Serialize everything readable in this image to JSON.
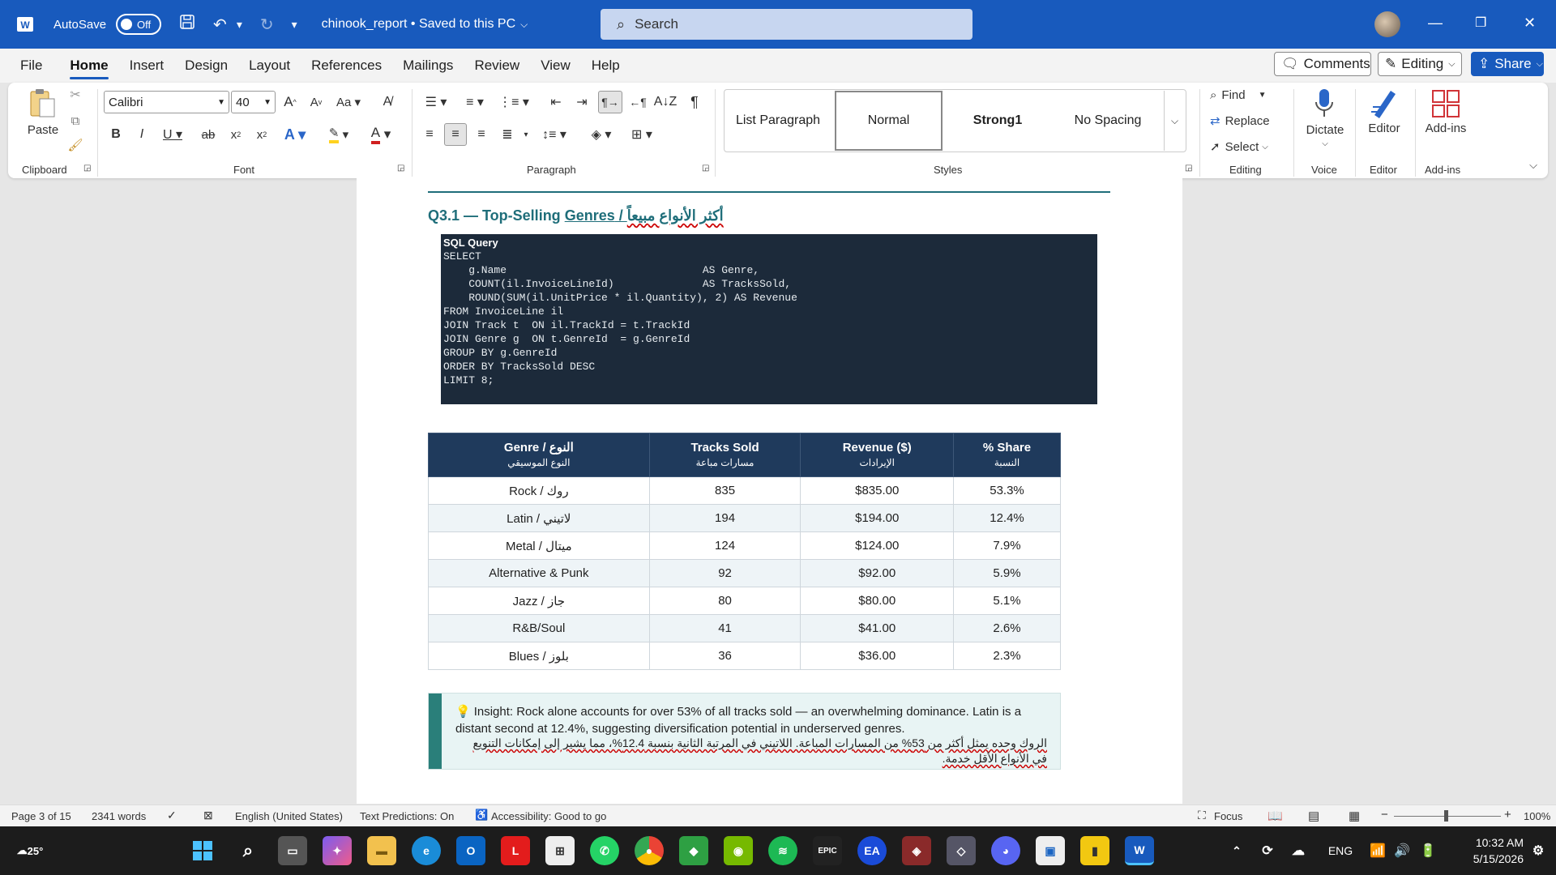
{
  "titlebar": {
    "autosave_label": "AutoSave",
    "autosave_state": "Off",
    "doc_title": "chinook_report • Saved to this PC",
    "search_placeholder": "Search"
  },
  "menu": {
    "items": [
      "File",
      "Home",
      "Insert",
      "Design",
      "Layout",
      "References",
      "Mailings",
      "Review",
      "View",
      "Help"
    ],
    "active": "Home",
    "comments_label": "Comments",
    "editing_label": "Editing",
    "share_label": "Share"
  },
  "ribbon": {
    "paste_label": "Paste",
    "clipboard_label": "Clipboard",
    "font_name": "Calibri",
    "font_size": "40",
    "font_group": "Font",
    "paragraph_group": "Paragraph",
    "styles": [
      "List Paragraph",
      "Normal",
      "Strong1",
      "No Spacing"
    ],
    "styles_group": "Styles",
    "find_label": "Find",
    "replace_label": "Replace",
    "select_label": "Select",
    "editing_group": "Editing",
    "dictate_label": "Dictate",
    "voice_group": "Voice",
    "editor_label": "Editor",
    "editor_group": "Editor",
    "addins_label": "Add-ins",
    "addins_group": "Add-ins"
  },
  "document": {
    "heading_prefix": "Q3.1 — Top-Selling ",
    "heading_genres": "Genres",
    "heading_sep": " / ",
    "heading_ar": "أكثر الأنواع مبيعاً",
    "code_header": "SQL Query",
    "code_body": "SELECT\n    g.Name                               AS Genre,\n    COUNT(il.InvoiceLineId)              AS TracksSold,\n    ROUND(SUM(il.UnitPrice * il.Quantity), 2) AS Revenue\nFROM InvoiceLine il\nJOIN Track t  ON il.TrackId = t.TrackId\nJOIN Genre g  ON t.GenreId  = g.GenreId\nGROUP BY g.GenreId\nORDER BY TracksSold DESC\nLIMIT 8;",
    "table": {
      "headers": [
        {
          "en": "Genre / النوع",
          "ar": "النوع الموسيقي"
        },
        {
          "en": "Tracks Sold",
          "ar": "مسارات مباعة"
        },
        {
          "en": "Revenue ($)",
          "ar": "الإيرادات"
        },
        {
          "en": "% Share",
          "ar": "النسبة"
        }
      ],
      "rows": [
        [
          "Rock / روك",
          "835",
          "$835.00",
          "53.3%"
        ],
        [
          "Latin / لاتيني",
          "194",
          "$194.00",
          "12.4%"
        ],
        [
          "Metal / ميتال",
          "124",
          "$124.00",
          "7.9%"
        ],
        [
          "Alternative & Punk",
          "92",
          "$92.00",
          "5.9%"
        ],
        [
          "Jazz / جاز",
          "80",
          "$80.00",
          "5.1%"
        ],
        [
          "R&B/Soul",
          "41",
          "$41.00",
          "2.6%"
        ],
        [
          "Blues / بلوز",
          "36",
          "$36.00",
          "2.3%"
        ]
      ]
    },
    "insight_en": "Insight: Rock alone accounts for over 53% of all tracks sold — an overwhelming dominance. Latin is a distant second at 12.4%, suggesting diversification potential in underserved genres.",
    "insight_ar": "الروك وحده يمثل أكثر من 53% من المسارات المباعة. اللاتيني في المرتبة الثانية بنسبة 12.4%، مما يشير إلى إمكانات التنويع في الأنواع الأقل خدمة."
  },
  "statusbar": {
    "page": "Page 3 of 15",
    "words": "2341 words",
    "language": "English (United States)",
    "predictions": "Text Predictions: On",
    "accessibility": "Accessibility: Good to go",
    "focus": "Focus",
    "zoom": "100%"
  },
  "taskbar": {
    "weather": "25°",
    "lang": "ENG",
    "time": "10:32 AM",
    "date": "5/15/2026"
  },
  "colors": {
    "titlebar": "#185abd",
    "table_header": "#1f3a5c",
    "accent_teal": "#1f6e7a"
  }
}
